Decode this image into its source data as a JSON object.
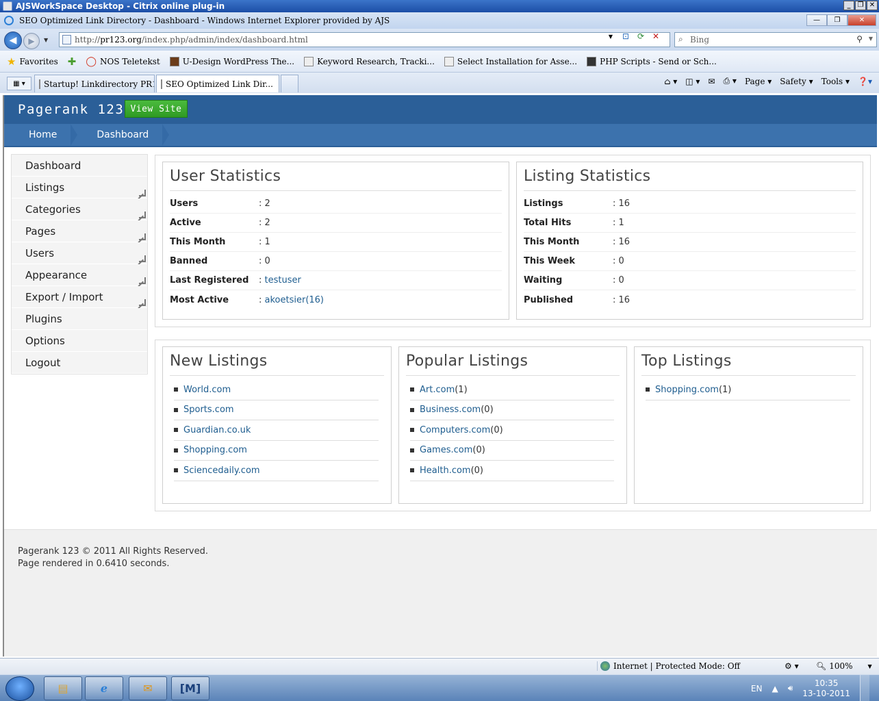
{
  "citrix": {
    "title": "AJSWorkSpace Desktop - Citrix online plug-in"
  },
  "browser": {
    "title": "SEO Optimized Link Directory - Dashboard - Windows Internet Explorer provided by AJS",
    "address_prefix": "http://",
    "address_host": "pr123.org",
    "address_path": "/index.php/admin/index/dashboard.html",
    "search_placeholder": "Bing",
    "favorites_label": "Favorites",
    "favorites": [
      "NOS Teletekst",
      "U-Design WordPress The...",
      "Keyword Research, Tracki...",
      "Select Installation for Asse...",
      "PHP Scripts - Send or Sch..."
    ],
    "tabs": [
      "Startup! Linkdirectory PR1...",
      "SEO Optimized Link Dir..."
    ],
    "commands": {
      "page": "Page",
      "safety": "Safety",
      "tools": "Tools"
    },
    "status_zone": "Internet | Protected Mode: Off",
    "zoom": "100%"
  },
  "app": {
    "brand": "Pagerank 123",
    "view_site": "View Site",
    "breadcrumbs": [
      "Home",
      "Dashboard"
    ],
    "sidebar": [
      "Dashboard",
      "Listings",
      "Categories",
      "Pages",
      "Users",
      "Appearance",
      "Export / Import",
      "Plugins",
      "Options",
      "Logout"
    ],
    "user_stats": {
      "title": "User Statistics",
      "rows": [
        {
          "label": "Users",
          "value": ": 2"
        },
        {
          "label": "Active",
          "value": ": 2"
        },
        {
          "label": "This Month",
          "value": ": 1"
        },
        {
          "label": "Banned",
          "value": ": 0"
        },
        {
          "label": "Last Registered",
          "prefix": ": ",
          "link": "testuser"
        },
        {
          "label": "Most Active",
          "prefix": ": ",
          "link": "akoetsier(16)"
        }
      ]
    },
    "listing_stats": {
      "title": "Listing Statistics",
      "rows": [
        {
          "label": "Listings",
          "value": ": 16"
        },
        {
          "label": "Total Hits",
          "value": ": 1"
        },
        {
          "label": "This Month",
          "value": ": 16"
        },
        {
          "label": "This Week",
          "value": ": 0"
        },
        {
          "label": "Waiting",
          "value": ": 0"
        },
        {
          "label": "Published",
          "value": ": 16"
        }
      ]
    },
    "new_listings": {
      "title": "New Listings",
      "items": [
        {
          "link": "World.com",
          "count": ""
        },
        {
          "link": "Sports.com",
          "count": ""
        },
        {
          "link": "Guardian.co.uk",
          "count": ""
        },
        {
          "link": "Shopping.com",
          "count": ""
        },
        {
          "link": "Sciencedaily.com",
          "count": ""
        }
      ]
    },
    "popular_listings": {
      "title": "Popular Listings",
      "items": [
        {
          "link": "Art.com",
          "count": " (1)"
        },
        {
          "link": "Business.com",
          "count": " (0)"
        },
        {
          "link": "Computers.com",
          "count": " (0)"
        },
        {
          "link": "Games.com",
          "count": " (0)"
        },
        {
          "link": "Health.com",
          "count": " (0)"
        }
      ]
    },
    "top_listings": {
      "title": "Top Listings",
      "items": [
        {
          "link": "Shopping.com",
          "count": " (1)"
        }
      ]
    },
    "footer": {
      "copyright": "Pagerank 123 © 2011 All Rights Reserved.",
      "rendered": "Page rendered in 0.6410 seconds."
    }
  },
  "taskbar": {
    "lang": "EN",
    "time": "10:35",
    "date": "13-10-2011",
    "mail_app": "[M]"
  }
}
